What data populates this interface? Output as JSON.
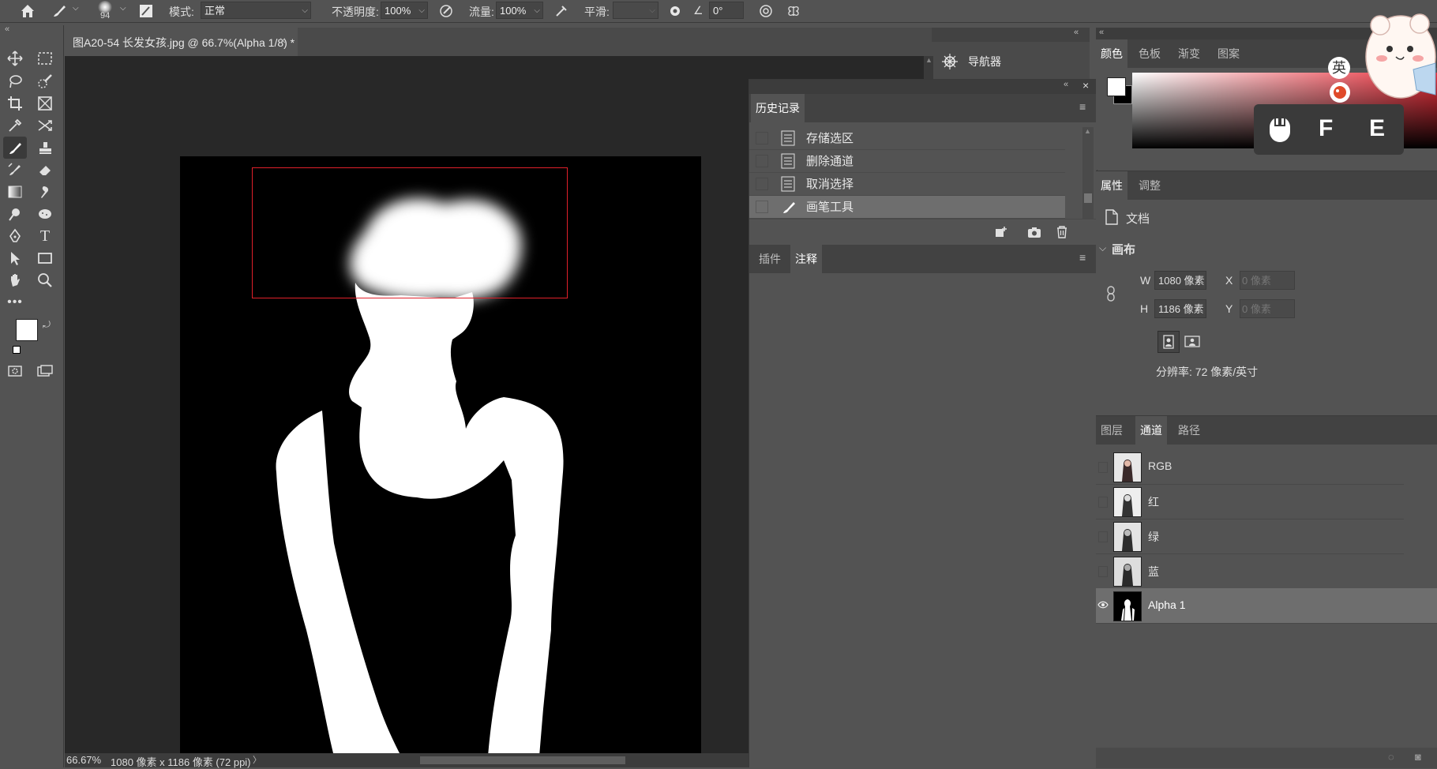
{
  "options_bar": {
    "brush_size": "94",
    "mode_label": "模式:",
    "mode_value": "正常",
    "opacity_label": "不透明度:",
    "opacity_value": "100%",
    "flow_label": "流量:",
    "flow_value": "100%",
    "smooth_label": "平滑:",
    "smooth_value": "",
    "angle_value": "0°"
  },
  "document": {
    "tab_title": "图A20-54 长发女孩.jpg @ 66.7%(Alpha 1/8) *",
    "close_glyph": "×"
  },
  "status_bar": {
    "zoom": "66.67%",
    "doc_info": "1080 像素 x 1186 像素 (72 ppi)",
    "nav_glyph": "〉"
  },
  "navigator": {
    "title": "导航器"
  },
  "history_panel": {
    "tab_label": "历史记录",
    "items": [
      {
        "label": "存储选区"
      },
      {
        "label": "删除通道"
      },
      {
        "label": "取消选择"
      },
      {
        "label": "画笔工具"
      }
    ]
  },
  "notes_panel": {
    "tabs": [
      "插件",
      "注释"
    ]
  },
  "color_panel": {
    "tabs": [
      "颜色",
      "色板",
      "渐变",
      "图案"
    ]
  },
  "properties_panel": {
    "tabs": [
      "属性",
      "调整"
    ],
    "doc_label": "文档",
    "canvas_section": "画布",
    "w_label": "W",
    "w_value": "1080 像素",
    "h_label": "H",
    "h_value": "1186 像素",
    "x_label": "X",
    "x_placeholder": "0 像素",
    "y_label": "Y",
    "y_placeholder": "0 像素",
    "resolution": "分辨率: 72 像素/英寸"
  },
  "channels_panel": {
    "tabs": [
      "图层",
      "通道",
      "路径"
    ],
    "channels": [
      {
        "name": "RGB"
      },
      {
        "name": "红"
      },
      {
        "name": "绿"
      },
      {
        "name": "蓝"
      },
      {
        "name": "Alpha 1"
      }
    ]
  },
  "overlay": {
    "ime_label": "英",
    "key_f": "F",
    "key_e": "E"
  },
  "colors": {
    "panel_bg": "#535353",
    "canvas_bg": "#282828",
    "selection_rect": "#e0202a",
    "gradient_red": "#e8303c"
  }
}
